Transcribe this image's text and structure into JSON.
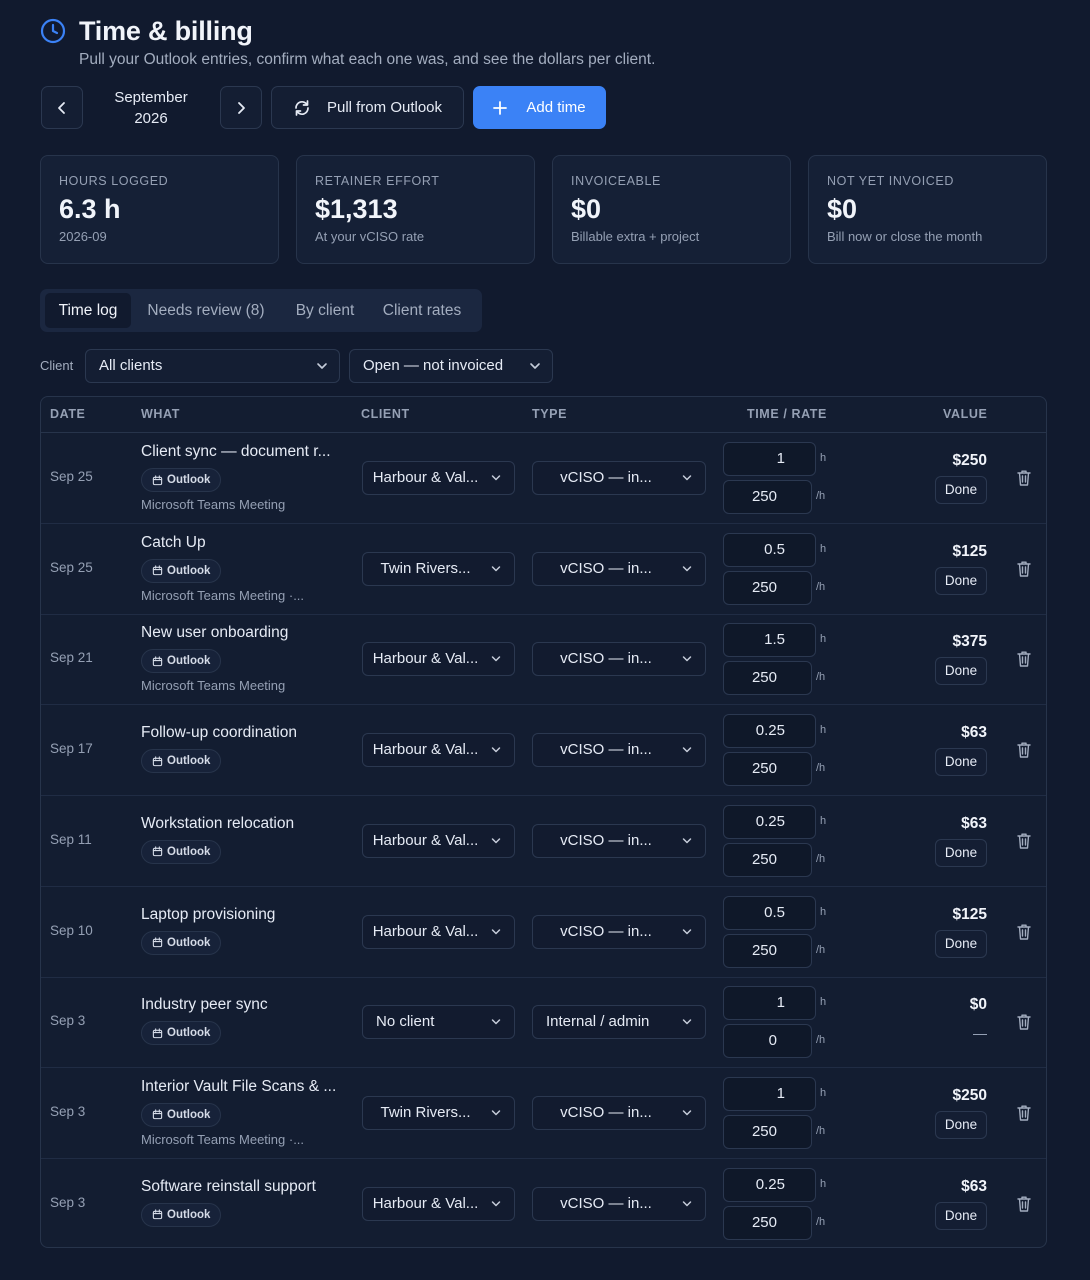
{
  "header": {
    "title": "Time & billing",
    "subtitle": "Pull your Outlook entries, confirm what each one was, and see the dollars per client.",
    "month_line1": "September",
    "month_line2": "2026",
    "pull_label": "Pull from Outlook",
    "add_label": "Add time"
  },
  "stats": [
    {
      "label": "HOURS LOGGED",
      "value": "6.3 h",
      "sub": "2026-09"
    },
    {
      "label": "RETAINER EFFORT",
      "value": "$1,313",
      "sub": "At your vCISO rate"
    },
    {
      "label": "INVOICEABLE",
      "value": "$0",
      "sub": "Billable extra + project"
    },
    {
      "label": "NOT YET INVOICED",
      "value": "$0",
      "sub": "Bill now or close the month"
    }
  ],
  "tabs": [
    "Time log",
    "Needs review (8)",
    "By client",
    "Client rates"
  ],
  "filters": {
    "client_label": "Client",
    "client_value": "All clients",
    "status_value": "Open — not invoiced"
  },
  "table": {
    "headers": [
      "DATE",
      "WHAT",
      "CLIENT",
      "TYPE",
      "TIME / RATE",
      "VALUE"
    ],
    "unit_hours": "h",
    "unit_rate": "/h",
    "chip_label": "Outlook",
    "done_label": "Done",
    "rows": [
      {
        "date": "Sep 25",
        "title": "Client sync — document r...",
        "source": "Microsoft Teams Meeting",
        "client": "Harbour & Val...",
        "type": "vCISO — in...",
        "hours": "1",
        "rate": "250",
        "value": "$250",
        "done": true
      },
      {
        "date": "Sep 25",
        "title": "Catch Up",
        "source": "Microsoft Teams Meeting ·...",
        "client": "Twin Rivers...",
        "type": "vCISO — in...",
        "hours": "0.5",
        "rate": "250",
        "value": "$125",
        "done": true
      },
      {
        "date": "Sep 21",
        "title": "New user onboarding",
        "source": "Microsoft Teams Meeting",
        "client": "Harbour & Val...",
        "type": "vCISO — in...",
        "hours": "1.5",
        "rate": "250",
        "value": "$375",
        "done": true
      },
      {
        "date": "Sep 17",
        "title": "Follow-up coordination",
        "source": "",
        "client": "Harbour & Val...",
        "type": "vCISO — in...",
        "hours": "0.25",
        "rate": "250",
        "value": "$63",
        "done": true
      },
      {
        "date": "Sep 11",
        "title": "Workstation relocation",
        "source": "",
        "client": "Harbour & Val...",
        "type": "vCISO — in...",
        "hours": "0.25",
        "rate": "250",
        "value": "$63",
        "done": true
      },
      {
        "date": "Sep 10",
        "title": "Laptop provisioning",
        "source": "",
        "client": "Harbour & Val...",
        "type": "vCISO — in...",
        "hours": "0.5",
        "rate": "250",
        "value": "$125",
        "done": true
      },
      {
        "date": "Sep 3",
        "title": "Industry peer sync",
        "source": "",
        "client": "No client",
        "type": "Internal / admin",
        "hours": "1",
        "rate": "0",
        "value": "$0",
        "done": false
      },
      {
        "date": "Sep 3",
        "title": "Interior Vault File Scans & ...",
        "source": "Microsoft Teams Meeting ·...",
        "client": "Twin Rivers...",
        "type": "vCISO — in...",
        "hours": "1",
        "rate": "250",
        "value": "$250",
        "done": true
      },
      {
        "date": "Sep 3",
        "title": "Software reinstall support",
        "source": "",
        "client": "Harbour & Val...",
        "type": "vCISO — in...",
        "hours": "0.25",
        "rate": "250",
        "value": "$63",
        "done": true
      }
    ]
  },
  "colors": {
    "accent": "#3b82f6",
    "background": "#111a2e",
    "panel": "#152036"
  }
}
